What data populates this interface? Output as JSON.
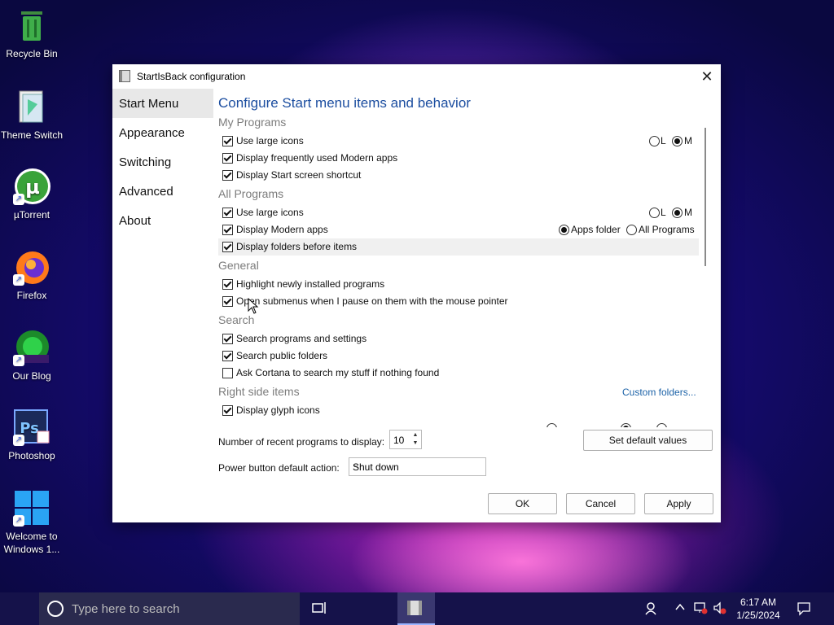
{
  "desktop": {
    "icons": [
      {
        "label": "Recycle Bin"
      },
      {
        "label": "Theme Switch"
      },
      {
        "label": "µTorrent"
      },
      {
        "label": "Firefox"
      },
      {
        "label": "Our Blog"
      },
      {
        "label": "Photoshop"
      },
      {
        "label": "Welcome to Windows 1..."
      }
    ]
  },
  "dialog": {
    "title": "StartIsBack configuration",
    "nav": [
      "Start Menu",
      "Appearance",
      "Switching",
      "Advanced",
      "About"
    ],
    "heading": "Configure Start menu items and behavior",
    "sections": {
      "my_programs": "My Programs",
      "all_programs": "All Programs",
      "general": "General",
      "search": "Search",
      "right_side": "Right side items"
    },
    "options": {
      "mp_large_icons": "Use large icons",
      "mp_frequent_modern": "Display frequently used Modern apps",
      "mp_start_screen": "Display Start screen shortcut",
      "ap_large_icons": "Use large icons",
      "ap_modern_apps": "Display Modern apps",
      "ap_folders_first": "Display folders before items",
      "gen_highlight": "Highlight newly installed programs",
      "gen_submenus": "Open submenus when I pause on them with the mouse pointer",
      "search_programs": "Search programs and settings",
      "search_public": "Search public folders",
      "search_cortana": "Ask Cortana to search my stuff if nothing found",
      "rs_glyph": "Display glyph icons"
    },
    "radios": {
      "L": "L",
      "M": "M",
      "apps_folder": "Apps folder",
      "all_programs": "All Programs"
    },
    "custom_folders": "Custom folders...",
    "recent_label": "Number of recent programs to display:",
    "recent_value": "10",
    "set_default": "Set default values",
    "power_label": "Power button default action:",
    "power_value": "Shut down",
    "ok": "OK",
    "cancel": "Cancel",
    "apply": "Apply"
  },
  "taskbar": {
    "search_placeholder": "Type here to search",
    "time": "6:17 AM",
    "date": "1/25/2024"
  }
}
